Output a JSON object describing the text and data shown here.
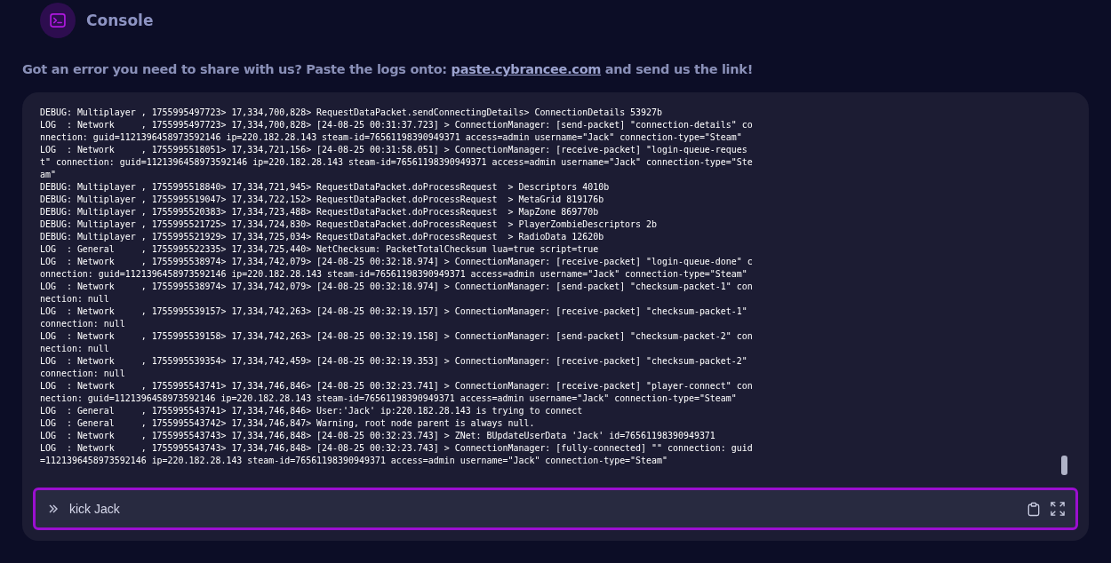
{
  "header": {
    "title": "Console"
  },
  "notice": {
    "before": "Got an error you need to share with us? Paste the logs onto:",
    "link": "paste.cybrancee.com",
    "after": "and send us the link!"
  },
  "log": {
    "lines": [
      "DEBUG: Multiplayer , 1755995497723> 17,334,700,828> RequestDataPacket.sendConnectingDetails> ConnectionDetails 53927b",
      "LOG  : Network     , 1755995497723> 17,334,700,828> [24-08-25 00:31:37.723] > ConnectionManager: [send-packet] \"connection-details\" connection: guid=1121396458973592146 ip=220.182.28.143 steam-id=76561198390949371 access=admin username=\"Jack\" connection-type=\"Steam\"",
      "LOG  : Network     , 1755995518051> 17,334,721,156> [24-08-25 00:31:58.051] > ConnectionManager: [receive-packet] \"login-queue-request\" connection: guid=1121396458973592146 ip=220.182.28.143 steam-id=76561198390949371 access=admin username=\"Jack\" connection-type=\"Steam\"",
      "DEBUG: Multiplayer , 1755995518840> 17,334,721,945> RequestDataPacket.doProcessRequest  > Descriptors 4010b",
      "DEBUG: Multiplayer , 1755995519047> 17,334,722,152> RequestDataPacket.doProcessRequest  > MetaGrid 819176b",
      "DEBUG: Multiplayer , 1755995520383> 17,334,723,488> RequestDataPacket.doProcessRequest  > MapZone 869770b",
      "DEBUG: Multiplayer , 1755995521725> 17,334,724,830> RequestDataPacket.doProcessRequest  > PlayerZombieDescriptors 2b",
      "DEBUG: Multiplayer , 1755995521929> 17,334,725,034> RequestDataPacket.doProcessRequest  > RadioData 12620b",
      "LOG  : General     , 1755995522335> 17,334,725,440> NetChecksum: PacketTotalChecksum lua=true script=true",
      "LOG  : Network     , 1755995538974> 17,334,742,079> [24-08-25 00:32:18.974] > ConnectionManager: [receive-packet] \"login-queue-done\" connection: guid=1121396458973592146 ip=220.182.28.143 steam-id=76561198390949371 access=admin username=\"Jack\" connection-type=\"Steam\"",
      "LOG  : Network     , 1755995538974> 17,334,742,079> [24-08-25 00:32:18.974] > ConnectionManager: [send-packet] \"checksum-packet-1\" connection: null",
      "LOG  : Network     , 1755995539157> 17,334,742,263> [24-08-25 00:32:19.157] > ConnectionManager: [receive-packet] \"checksum-packet-1\" connection: null",
      "LOG  : Network     , 1755995539158> 17,334,742,263> [24-08-25 00:32:19.158] > ConnectionManager: [send-packet] \"checksum-packet-2\" connection: null",
      "LOG  : Network     , 1755995539354> 17,334,742,459> [24-08-25 00:32:19.353] > ConnectionManager: [receive-packet] \"checksum-packet-2\" connection: null",
      "LOG  : Network     , 1755995543741> 17,334,746,846> [24-08-25 00:32:23.741] > ConnectionManager: [receive-packet] \"player-connect\" connection: guid=1121396458973592146 ip=220.182.28.143 steam-id=76561198390949371 access=admin username=\"Jack\" connection-type=\"Steam\"",
      "LOG  : General     , 1755995543741> 17,334,746,846> User:'Jack' ip:220.182.28.143 is trying to connect",
      "LOG  : General     , 1755995543742> 17,334,746,847> Warning, root node parent is always null.",
      "LOG  : Network     , 1755995543743> 17,334,746,848> [24-08-25 00:32:23.743] > ZNet: BUpdateUserData 'Jack' id=76561198390949371",
      "LOG  : Network     , 1755995543743> 17,334,746,848> [24-08-25 00:32:23.743] > ConnectionManager: [fully-connected] \"\" connection: guid=1121396458973592146 ip=220.182.28.143 steam-id=76561198390949371 access=admin username=\"Jack\" connection-type=\"Steam\""
    ]
  },
  "command_input": {
    "value": "kick Jack"
  }
}
